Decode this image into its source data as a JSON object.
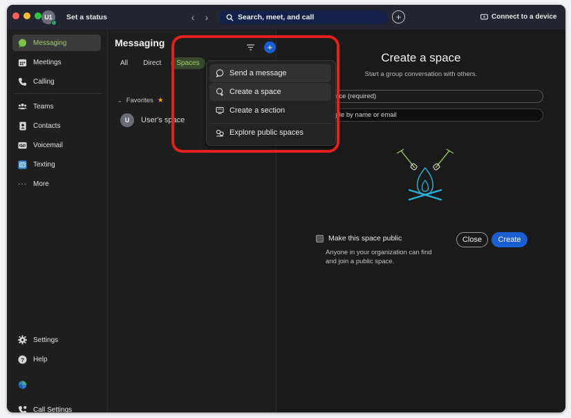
{
  "titlebar": {
    "avatar_initials": "U1",
    "set_status": "Set a status",
    "search_label": "Search, meet, and call",
    "connect_label": "Connect to a device"
  },
  "sidebar": {
    "items": [
      {
        "label": "Messaging",
        "icon": "chat-bubble-icon"
      },
      {
        "label": "Meetings",
        "icon": "calendar-icon"
      },
      {
        "label": "Calling",
        "icon": "phone-icon"
      },
      {
        "label": "Teams",
        "icon": "people-icon"
      },
      {
        "label": "Contacts",
        "icon": "contact-card-icon"
      },
      {
        "label": "Voicemail",
        "icon": "voicemail-icon"
      },
      {
        "label": "Texting",
        "icon": "sms-icon"
      },
      {
        "label": "More",
        "icon": "more-dots-icon"
      }
    ],
    "settings_label": "Settings",
    "help_label": "Help",
    "call_settings_label": "Call Settings"
  },
  "list": {
    "title": "Messaging",
    "tabs": [
      "All",
      "Direct",
      "Spaces"
    ],
    "favorites_label": "Favorites",
    "space_avatar": "U",
    "space_name": "User's space"
  },
  "menu": {
    "items": [
      {
        "label": "Send a message",
        "icon": "send-message-icon"
      },
      {
        "label": "Create a space",
        "icon": "create-space-icon"
      },
      {
        "label": "Create a section",
        "icon": "section-icon"
      },
      {
        "label": "Explore public spaces",
        "icon": "explore-icon"
      }
    ]
  },
  "create_space": {
    "title": "Create a space",
    "subtitle": "Start a group conversation with others.",
    "name_field": "space (required)",
    "people_field": "eople by name or email",
    "public_label": "Make this space public",
    "public_desc": "Anyone in your organization can find and join a public space.",
    "close_label": "Close",
    "create_label": "Create"
  },
  "colors": {
    "accent_green": "#9fd06a",
    "brand_blue": "#1a5fd1",
    "highlight_red": "#e5201c",
    "titlebar": "#232530"
  }
}
